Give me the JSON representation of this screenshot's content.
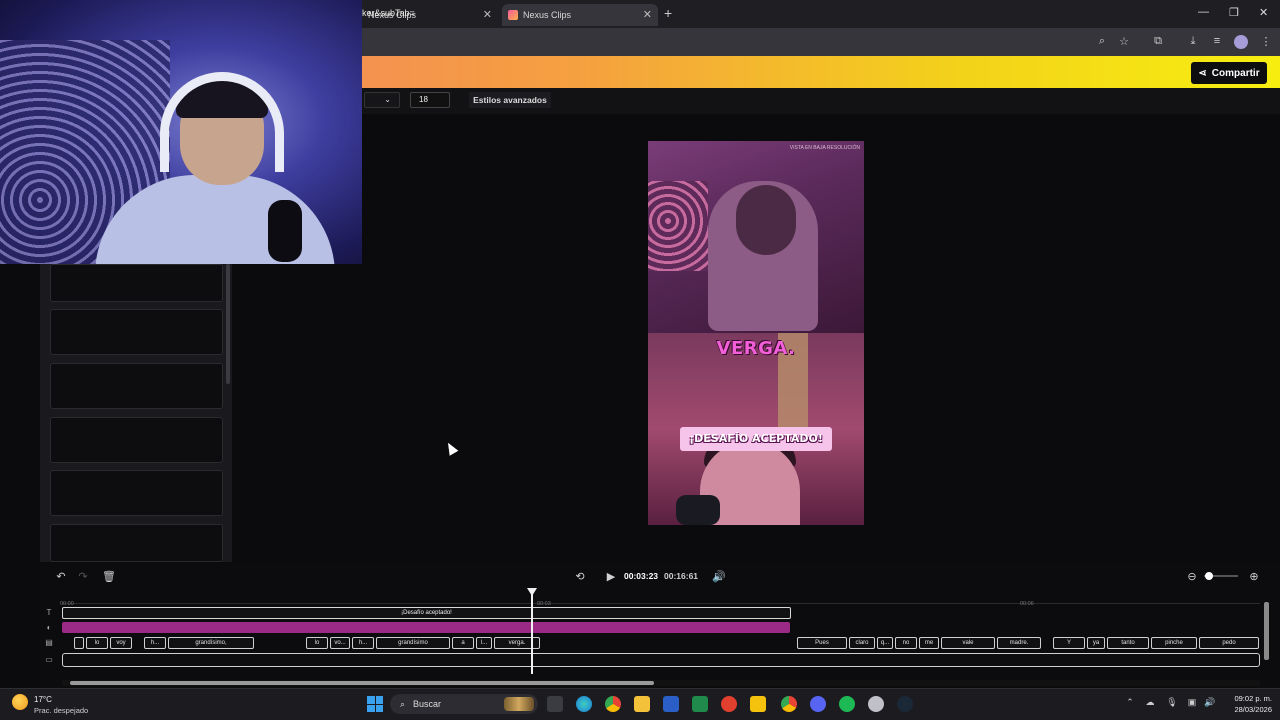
{
  "browser": {
    "tabs": [
      {
        "label": "Nexus Clips",
        "active": false
      },
      {
        "label": "Nexus Clips",
        "active": true
      }
    ],
    "url": "ker&subTab="
  },
  "header": {
    "share_label": "Compartir",
    "accent_gradient": [
      "#f27b6a",
      "#f5a040",
      "#f7ee10"
    ]
  },
  "toolbar": {
    "font_size_value": "18",
    "advanced_styles_label": "Estilos avanzados"
  },
  "preview": {
    "watermark": "VISTA EN BAJA RESOLUCIÓN",
    "title_text": "VERGA.",
    "caption_text": "¡DESAFÍO ACEPTADO!",
    "title_color": "#f25fd8"
  },
  "player": {
    "current_time": "00:03:23",
    "total_time": "00:16:61"
  },
  "timeline": {
    "ruler_ticks": [
      "00:00",
      "00:03",
      "00:06"
    ],
    "text_clip": "¡Desafío aceptado!",
    "captions": [
      "lo",
      "voy",
      "h...",
      "grandísimo,",
      "lo",
      "vo...",
      "h...",
      "grandísimo",
      "a",
      "l...",
      "verga.",
      "Pues",
      "claro",
      "q...",
      "no",
      "me",
      "vale",
      "madre.",
      "Y",
      "ya",
      "tanto",
      "pinche",
      "pedo"
    ],
    "magenta_color": "#9a2a86"
  },
  "taskbar": {
    "weather_temp": "17°C",
    "weather_desc": "Prac. despejado",
    "search_placeholder": "Buscar",
    "time": "09:02 p. m.",
    "date": "28/03/2026"
  }
}
